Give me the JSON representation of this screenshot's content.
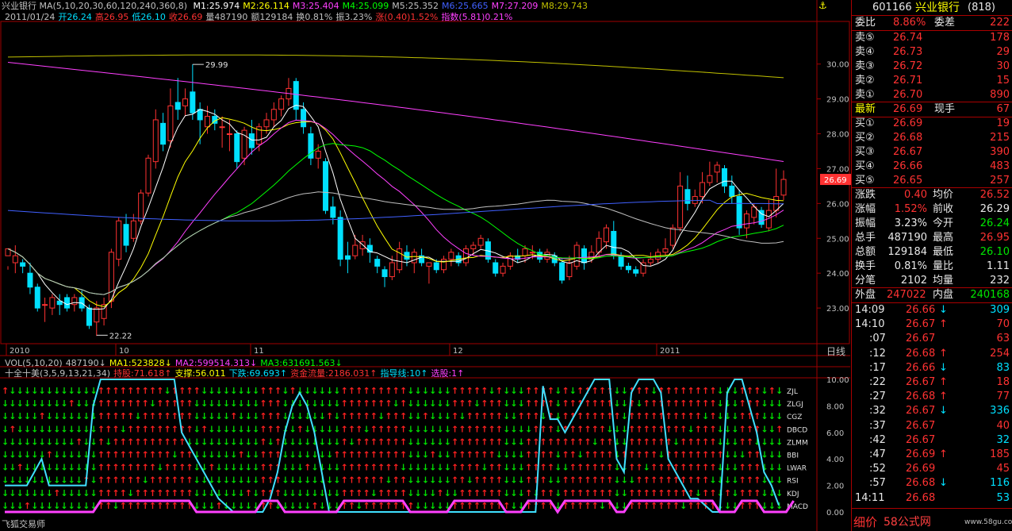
{
  "header": {
    "line1": "兴业银行  MA(5,10,20,30,60,120,240,360,8)",
    "ma_values": [
      {
        "label": "M1:25.974",
        "color": "#ffffff"
      },
      {
        "label": "M2:26.114",
        "color": "#ffff00"
      },
      {
        "label": "M3:25.404",
        "color": "#ff40ff"
      },
      {
        "label": "M4:25.099",
        "color": "#00ff00"
      },
      {
        "label": "M5:25.352",
        "color": "#c0c0c0"
      },
      {
        "label": "M6:25.665",
        "color": "#4060ff"
      },
      {
        "label": "M7:27.209",
        "color": "#ff40ff"
      },
      {
        "label": "M8:29.743",
        "color": "#c0c000"
      }
    ],
    "line2": [
      {
        "t": "2011/01/24",
        "c": "#c0c0c0"
      },
      {
        "t": "开26.24",
        "c": "#00e0ff"
      },
      {
        "t": "高26.95",
        "c": "#ff3232"
      },
      {
        "t": "低26.10",
        "c": "#00e0ff"
      },
      {
        "t": "收26.69",
        "c": "#ff3232"
      },
      {
        "t": "量487190",
        "c": "#c0c0c0"
      },
      {
        "t": "额129184",
        "c": "#c0c0c0"
      },
      {
        "t": "换0.81%",
        "c": "#c0c0c0"
      },
      {
        "t": "振3.23%",
        "c": "#c0c0c0"
      },
      {
        "t": "涨(0.40)1.52%",
        "c": "#ff3232"
      },
      {
        "t": "指数(5.81)0.21%",
        "c": "#ff40ff"
      }
    ]
  },
  "chart_data": [
    {
      "type": "candlestick",
      "title": "兴业银行 日线",
      "ylim": [
        22.0,
        31.2
      ],
      "y_ticks": [
        "30.00",
        "29.00",
        "28.00",
        "27.00",
        "26.00",
        "25.00",
        "24.00",
        "23.00"
      ],
      "x_ticks": [
        "2010",
        "10",
        "11",
        "12",
        "2011"
      ],
      "period_label": "日线",
      "annotations": [
        "29.99",
        "22.22"
      ],
      "current_price_tag": "26.69",
      "candles": [
        [
          24.5,
          24.7,
          24.2,
          24.1
        ],
        [
          24.3,
          24.5,
          24.8,
          24.0
        ],
        [
          24.3,
          24.2,
          24.4,
          24.0
        ],
        [
          24.0,
          23.6,
          24.3,
          23.4
        ],
        [
          23.6,
          23.0,
          23.7,
          22.9
        ],
        [
          23.1,
          23.1,
          23.3,
          22.6
        ],
        [
          23.0,
          23.3,
          23.4,
          22.8
        ],
        [
          23.2,
          23.1,
          23.4,
          22.8
        ],
        [
          23.3,
          23.0,
          23.4,
          22.9
        ],
        [
          23.1,
          23.3,
          23.4,
          22.9
        ],
        [
          23.3,
          23.0,
          23.5,
          22.9
        ],
        [
          23.0,
          22.5,
          23.1,
          22.4
        ],
        [
          22.6,
          23.0,
          23.2,
          22.2
        ],
        [
          22.7,
          23.1,
          23.3,
          22.5
        ],
        [
          23.2,
          24.6,
          24.7,
          23.0
        ],
        [
          24.4,
          25.5,
          25.6,
          24.2
        ],
        [
          25.4,
          24.8,
          25.7,
          24.6
        ],
        [
          25.0,
          25.5,
          25.7,
          24.9
        ],
        [
          25.5,
          26.3,
          26.4,
          25.4
        ],
        [
          26.3,
          27.3,
          27.4,
          26.2
        ],
        [
          27.2,
          28.4,
          28.7,
          27.0
        ],
        [
          28.3,
          27.7,
          28.6,
          27.5
        ],
        [
          27.8,
          28.8,
          29.3,
          27.6
        ],
        [
          28.9,
          28.7,
          29.6,
          28.4
        ],
        [
          28.8,
          29.0,
          29.3,
          28.5
        ],
        [
          29.2,
          28.6,
          29.99,
          28.4
        ],
        [
          28.7,
          28.4,
          28.9,
          27.7
        ],
        [
          28.2,
          28.5,
          28.8,
          28.0
        ],
        [
          28.5,
          28.3,
          28.7,
          28.1
        ],
        [
          28.2,
          28.2,
          28.5,
          27.6
        ],
        [
          28.0,
          28.0,
          28.4,
          27.5
        ],
        [
          28.0,
          27.2,
          28.1,
          27.0
        ],
        [
          27.3,
          28.1,
          28.2,
          27.1
        ],
        [
          28.0,
          27.6,
          28.4,
          27.4
        ],
        [
          27.7,
          28.2,
          28.3,
          27.5
        ],
        [
          28.2,
          28.4,
          28.6,
          28.0
        ],
        [
          28.4,
          28.7,
          28.9,
          28.2
        ],
        [
          28.7,
          29.0,
          29.1,
          28.5
        ],
        [
          29.0,
          29.3,
          29.6,
          28.8
        ],
        [
          29.5,
          28.7,
          29.6,
          28.4
        ],
        [
          28.7,
          28.2,
          28.9,
          28.0
        ],
        [
          28.0,
          27.3,
          28.2,
          27.1
        ],
        [
          27.3,
          27.5,
          27.7,
          27.0
        ],
        [
          27.2,
          25.8,
          27.3,
          25.7
        ],
        [
          25.9,
          25.6,
          26.2,
          25.4
        ],
        [
          25.6,
          24.4,
          25.8,
          24.2
        ],
        [
          24.5,
          24.4,
          24.9,
          24.0
        ],
        [
          24.5,
          24.8,
          25.1,
          24.4
        ],
        [
          24.7,
          24.9,
          25.1,
          24.5
        ],
        [
          24.8,
          24.6,
          25.0,
          24.3
        ],
        [
          24.4,
          24.2,
          24.5,
          24.0
        ],
        [
          24.1,
          23.9,
          24.2,
          23.6
        ],
        [
          23.9,
          24.3,
          24.5,
          23.8
        ],
        [
          24.1,
          24.7,
          24.9,
          24.0
        ],
        [
          24.6,
          24.4,
          24.8,
          24.2
        ],
        [
          24.3,
          24.6,
          24.7,
          24.0
        ],
        [
          24.5,
          24.3,
          24.7,
          24.2
        ],
        [
          24.2,
          24.3,
          24.3,
          23.7
        ],
        [
          24.3,
          24.1,
          24.4,
          24.0
        ],
        [
          24.1,
          24.4,
          24.5,
          24.0
        ],
        [
          24.4,
          24.6,
          24.7,
          24.2
        ],
        [
          24.5,
          24.3,
          24.6,
          24.2
        ],
        [
          24.3,
          24.7,
          24.8,
          24.2
        ],
        [
          24.7,
          24.8,
          24.9,
          24.5
        ],
        [
          24.8,
          25.0,
          25.1,
          24.7
        ],
        [
          24.9,
          24.4,
          25.0,
          24.3
        ],
        [
          24.3,
          24.0,
          24.4,
          23.9
        ],
        [
          24.0,
          24.2,
          24.3,
          23.9
        ],
        [
          24.2,
          24.5,
          24.6,
          24.1
        ],
        [
          24.5,
          24.4,
          24.7,
          24.3
        ],
        [
          24.5,
          24.7,
          24.8,
          24.3
        ],
        [
          24.6,
          24.6,
          24.8,
          24.4
        ],
        [
          24.6,
          24.4,
          24.7,
          24.3
        ],
        [
          24.4,
          24.6,
          24.7,
          24.3
        ],
        [
          24.5,
          24.3,
          24.6,
          24.2
        ],
        [
          24.3,
          23.8,
          24.4,
          23.7
        ],
        [
          23.9,
          24.3,
          24.5,
          23.8
        ],
        [
          24.2,
          24.8,
          24.9,
          24.1
        ],
        [
          24.7,
          24.3,
          24.8,
          24.1
        ],
        [
          24.4,
          24.6,
          24.8,
          24.3
        ],
        [
          24.6,
          25.0,
          25.2,
          24.5
        ],
        [
          24.9,
          25.3,
          25.4,
          24.7
        ],
        [
          25.2,
          24.5,
          25.5,
          24.4
        ],
        [
          24.5,
          24.2,
          24.6,
          24.1
        ],
        [
          24.2,
          24.1,
          24.3,
          24.0
        ],
        [
          24.1,
          24.0,
          24.2,
          23.9
        ],
        [
          24.0,
          24.3,
          24.4,
          23.9
        ],
        [
          24.3,
          24.4,
          24.6,
          24.2
        ],
        [
          24.4,
          24.6,
          24.7,
          24.3
        ],
        [
          24.6,
          24.7,
          25.0,
          24.5
        ],
        [
          24.8,
          25.3,
          25.4,
          24.7
        ],
        [
          25.3,
          26.5,
          26.9,
          25.2
        ],
        [
          26.4,
          26.0,
          26.8,
          25.8
        ],
        [
          26.0,
          26.2,
          26.4,
          25.9
        ],
        [
          26.2,
          26.6,
          26.9,
          26.0
        ],
        [
          26.6,
          26.8,
          27.2,
          26.5
        ],
        [
          26.9,
          27.1,
          27.2,
          26.6
        ],
        [
          27.0,
          26.5,
          27.1,
          26.3
        ],
        [
          26.5,
          26.2,
          26.8,
          26.0
        ],
        [
          26.2,
          25.3,
          26.4,
          25.1
        ],
        [
          25.3,
          25.7,
          25.8,
          25.0
        ],
        [
          25.6,
          25.9,
          26.0,
          25.4
        ],
        [
          25.8,
          25.4,
          25.9,
          25.3
        ],
        [
          25.3,
          25.8,
          26.1,
          25.2
        ],
        [
          25.8,
          26.2,
          27.0,
          25.6
        ],
        [
          26.24,
          26.69,
          26.95,
          26.1
        ]
      ],
      "ma_lines": [
        {
          "name": "M1",
          "color": "#ffffff"
        },
        {
          "name": "M2",
          "color": "#ffff00"
        },
        {
          "name": "M3",
          "color": "#ff40ff"
        },
        {
          "name": "M4",
          "color": "#00ff00"
        },
        {
          "name": "M5",
          "color": "#c0c0c0"
        },
        {
          "name": "M6",
          "color": "#4060ff"
        },
        {
          "name": "M7",
          "color": "#ff40ff"
        },
        {
          "name": "M8",
          "color": "#c0c000"
        }
      ]
    },
    {
      "type": "indicator",
      "vol_header": [
        {
          "t": "VOL(5,10,20)",
          "c": "#c0c0c0"
        },
        {
          "t": "487190↓",
          "c": "#c0c0c0"
        },
        {
          "t": "MA1:523828↓",
          "c": "#ffff00"
        },
        {
          "t": "MA2:599514.313↓",
          "c": "#ff40ff"
        },
        {
          "t": "MA3:631691.563↓",
          "c": "#00ff00"
        }
      ],
      "ind_header": [
        {
          "t": "十全十美(3,5,9,13,21,34)",
          "c": "#c0c0c0"
        },
        {
          "t": "持股:71.618↑",
          "c": "#ff3232"
        },
        {
          "t": "支撑:56.011",
          "c": "#ffff00"
        },
        {
          "t": "下跌:69.693↑",
          "c": "#00e0ff"
        },
        {
          "t": "资金流量:2186.031↑",
          "c": "#ff3232"
        },
        {
          "t": "指导线:10↑",
          "c": "#00e0ff"
        },
        {
          "t": "选股:1↑",
          "c": "#ff40ff"
        }
      ],
      "ylim": [
        0,
        10
      ],
      "y_ticks": [
        "10.00",
        "8.00",
        "6.00",
        "4.00",
        "2.00",
        "0.00"
      ],
      "row_labels": [
        "ZJL",
        "ZLGJ",
        "CGZ",
        "DBCD",
        "ZLMM",
        "BBI",
        "LWAR",
        "RSI",
        "KDJ",
        "MACD"
      ],
      "guide_line": [
        2,
        2,
        2,
        2,
        3,
        4,
        2,
        2,
        2,
        2,
        2,
        2,
        8,
        10,
        10,
        10,
        10,
        10,
        10,
        10,
        10,
        10,
        10,
        10,
        6,
        5,
        4,
        3,
        2,
        1,
        0.5,
        0,
        0,
        0,
        0,
        0,
        1,
        3,
        6,
        8,
        9,
        8,
        6,
        3,
        0,
        0,
        0,
        0,
        0,
        0,
        0,
        0,
        0,
        0,
        0,
        0,
        0,
        0,
        0,
        0,
        0,
        0,
        0,
        0,
        0,
        0,
        0,
        0,
        0,
        0,
        0,
        0,
        0,
        9.5,
        7,
        7,
        6,
        7,
        8,
        9,
        10,
        10,
        10,
        4,
        3,
        9,
        10,
        10,
        10,
        9,
        4,
        3,
        2,
        1,
        1,
        0.5,
        0,
        0,
        9,
        10,
        10,
        8,
        6,
        3,
        2,
        0.5
      ],
      "hold_line": [
        0,
        0,
        0,
        0,
        0,
        0,
        0,
        0,
        0,
        0,
        0,
        0,
        0,
        1,
        1,
        1,
        1,
        1,
        1,
        1,
        1,
        1,
        1,
        1,
        1,
        1,
        0,
        0,
        0,
        0,
        0,
        0,
        0,
        0,
        0,
        1,
        1,
        1,
        0,
        0,
        0,
        0,
        0,
        0,
        0,
        0,
        1,
        1,
        1,
        1,
        1,
        1,
        1,
        1,
        1,
        0,
        0,
        0,
        0,
        0,
        0,
        1,
        1,
        1,
        1,
        1,
        1,
        1,
        0,
        0,
        0,
        1,
        1,
        1,
        1,
        0,
        1,
        1,
        1,
        1,
        1,
        1,
        1,
        0,
        0,
        1,
        1,
        1,
        1,
        1,
        1,
        1,
        1,
        1,
        1,
        1,
        1,
        0,
        0,
        0,
        1,
        1,
        1,
        0,
        0,
        0,
        0,
        1
      ],
      "arrows_up_ratio": 0.5
    }
  ],
  "right_panel": {
    "code": "601166",
    "name": "兴业银行",
    "code_suffix": "(818)",
    "ratio_label": "委比",
    "ratio_value": "8.86%",
    "diff_label": "委差",
    "diff_value": "222",
    "asks": [
      {
        "label": "卖⑤",
        "price": "26.74",
        "vol": "178"
      },
      {
        "label": "卖④",
        "price": "26.73",
        "vol": "29"
      },
      {
        "label": "卖③",
        "price": "26.72",
        "vol": "30"
      },
      {
        "label": "卖②",
        "price": "26.71",
        "vol": "15"
      },
      {
        "label": "卖①",
        "price": "26.70",
        "vol": "890"
      }
    ],
    "latest_label": "最新",
    "latest_price": "26.69",
    "hand_label": "现手",
    "hand_value": "67",
    "bids": [
      {
        "label": "买①",
        "price": "26.69",
        "vol": "19"
      },
      {
        "label": "买②",
        "price": "26.68",
        "vol": "215"
      },
      {
        "label": "买③",
        "price": "26.67",
        "vol": "390"
      },
      {
        "label": "买④",
        "price": "26.66",
        "vol": "483"
      },
      {
        "label": "买⑤",
        "price": "26.65",
        "vol": "257"
      }
    ],
    "stats": [
      {
        "l1": "涨跌",
        "v1": "0.40",
        "c1": "red",
        "l2": "均价",
        "v2": "26.52",
        "c2": "red"
      },
      {
        "l1": "涨幅",
        "v1": "1.52%",
        "c1": "red",
        "l2": "前收",
        "v2": "26.29",
        "c2": "wht"
      },
      {
        "l1": "振幅",
        "v1": "3.23%",
        "c1": "wht",
        "l2": "今开",
        "v2": "26.24",
        "c2": "grn"
      },
      {
        "l1": "总手",
        "v1": "487190",
        "c1": "wht",
        "l2": "最高",
        "v2": "26.95",
        "c2": "red"
      },
      {
        "l1": "总额",
        "v1": "129184",
        "c1": "wht",
        "l2": "最低",
        "v2": "26.10",
        "c2": "grn"
      },
      {
        "l1": "换手",
        "v1": "0.81%",
        "c1": "wht",
        "l2": "量比",
        "v2": "1.11",
        "c2": "wht"
      },
      {
        "l1": "分笔",
        "v1": "2102",
        "c1": "wht",
        "l2": "均量",
        "v2": "232",
        "c2": "wht"
      }
    ],
    "outer_label": "外盘",
    "outer_value": "247022",
    "inner_label": "内盘",
    "inner_value": "240168",
    "ticks": [
      {
        "time": "14:09",
        "price": "26.66",
        "dir": "↓",
        "vol": "309",
        "vc": "cyn"
      },
      {
        "time": "14:10",
        "price": "26.67",
        "dir": "↑",
        "vol": "70",
        "vc": "red"
      },
      {
        "time": ":07",
        "price": "26.67",
        "dir": "",
        "vol": "63",
        "vc": "red"
      },
      {
        "time": ":12",
        "price": "26.68",
        "dir": "↑",
        "vol": "254",
        "vc": "red"
      },
      {
        "time": ":17",
        "price": "26.66",
        "dir": "↓",
        "vol": "83",
        "vc": "cyn"
      },
      {
        "time": ":22",
        "price": "26.67",
        "dir": "↑",
        "vol": "18",
        "vc": "red"
      },
      {
        "time": ":27",
        "price": "26.68",
        "dir": "↑",
        "vol": "77",
        "vc": "red"
      },
      {
        "time": ":32",
        "price": "26.67",
        "dir": "↓",
        "vol": "336",
        "vc": "cyn"
      },
      {
        "time": ":37",
        "price": "26.67",
        "dir": "",
        "vol": "40",
        "vc": "red"
      },
      {
        "time": ":42",
        "price": "26.67",
        "dir": "",
        "vol": "32",
        "vc": "cyn"
      },
      {
        "time": ":47",
        "price": "26.69",
        "dir": "↑",
        "vol": "185",
        "vc": "red"
      },
      {
        "time": ":52",
        "price": "26.69",
        "dir": "",
        "vol": "45",
        "vc": "red"
      },
      {
        "time": ":57",
        "price": "26.68",
        "dir": "↓",
        "vol": "116",
        "vc": "cyn"
      },
      {
        "time": "14:11",
        "price": "26.68",
        "dir": "",
        "vol": "53",
        "vc": "cyn"
      }
    ],
    "footer_label": "细价",
    "watermark": "58公式网",
    "watermark_url": "www.58gu.com"
  },
  "footer": {
    "app_name": "飞狐交易师"
  },
  "colors": {
    "up": "#ff3232",
    "down": "#00e0ff",
    "grid": "#a00000",
    "bg": "#000000"
  }
}
